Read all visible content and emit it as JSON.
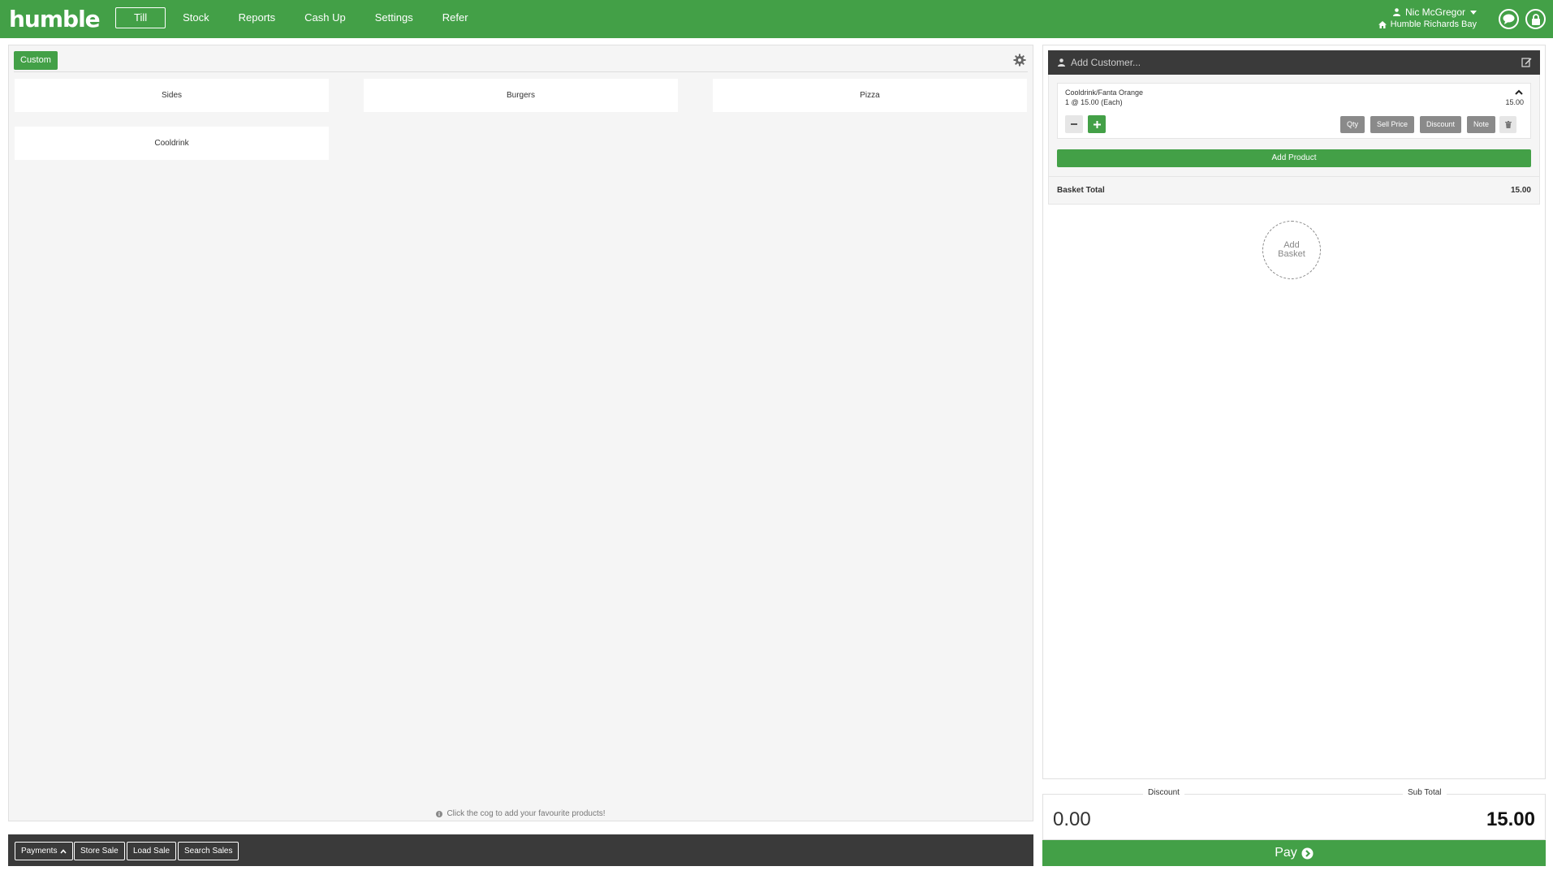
{
  "brand": {
    "logo": "humble"
  },
  "nav": [
    {
      "label": "Till",
      "active": true
    },
    {
      "label": "Stock"
    },
    {
      "label": "Reports"
    },
    {
      "label": "Cash Up"
    },
    {
      "label": "Settings"
    },
    {
      "label": "Refer"
    }
  ],
  "user": {
    "name": "Nic McGregor",
    "store": "Humble Richards Bay"
  },
  "products": {
    "custom_label": "Custom",
    "tiles": [
      "Sides",
      "Burgers",
      "Pizza",
      "Cooldrink"
    ],
    "hint": "Click the cog to add your favourite products!"
  },
  "bottom_actions": {
    "payments": "Payments",
    "store_sale": "Store Sale",
    "load_sale": "Load Sale",
    "search_sales": "Search Sales"
  },
  "basket": {
    "customer_placeholder": "Add Customer...",
    "items": [
      {
        "name": "Cooldrink/Fanta Orange",
        "qty_line": "1 @ 15.00 (Each)",
        "price": "15.00"
      }
    ],
    "actions": {
      "qty": "Qty",
      "sell_price": "Sell Price",
      "discount": "Discount",
      "note": "Note"
    },
    "add_product": "Add Product",
    "total_label": "Basket Total",
    "total_value": "15.00",
    "add_basket_l1": "Add",
    "add_basket_l2": "Basket"
  },
  "totals": {
    "discount_label": "Discount",
    "discount_value": "0.00",
    "subtotal_label": "Sub Total",
    "subtotal_value": "15.00"
  },
  "pay_label": "Pay",
  "colors": {
    "brand_green": "#43a047",
    "dark_bar": "#3a3a3a",
    "grey_button": "#8a8a8a"
  }
}
